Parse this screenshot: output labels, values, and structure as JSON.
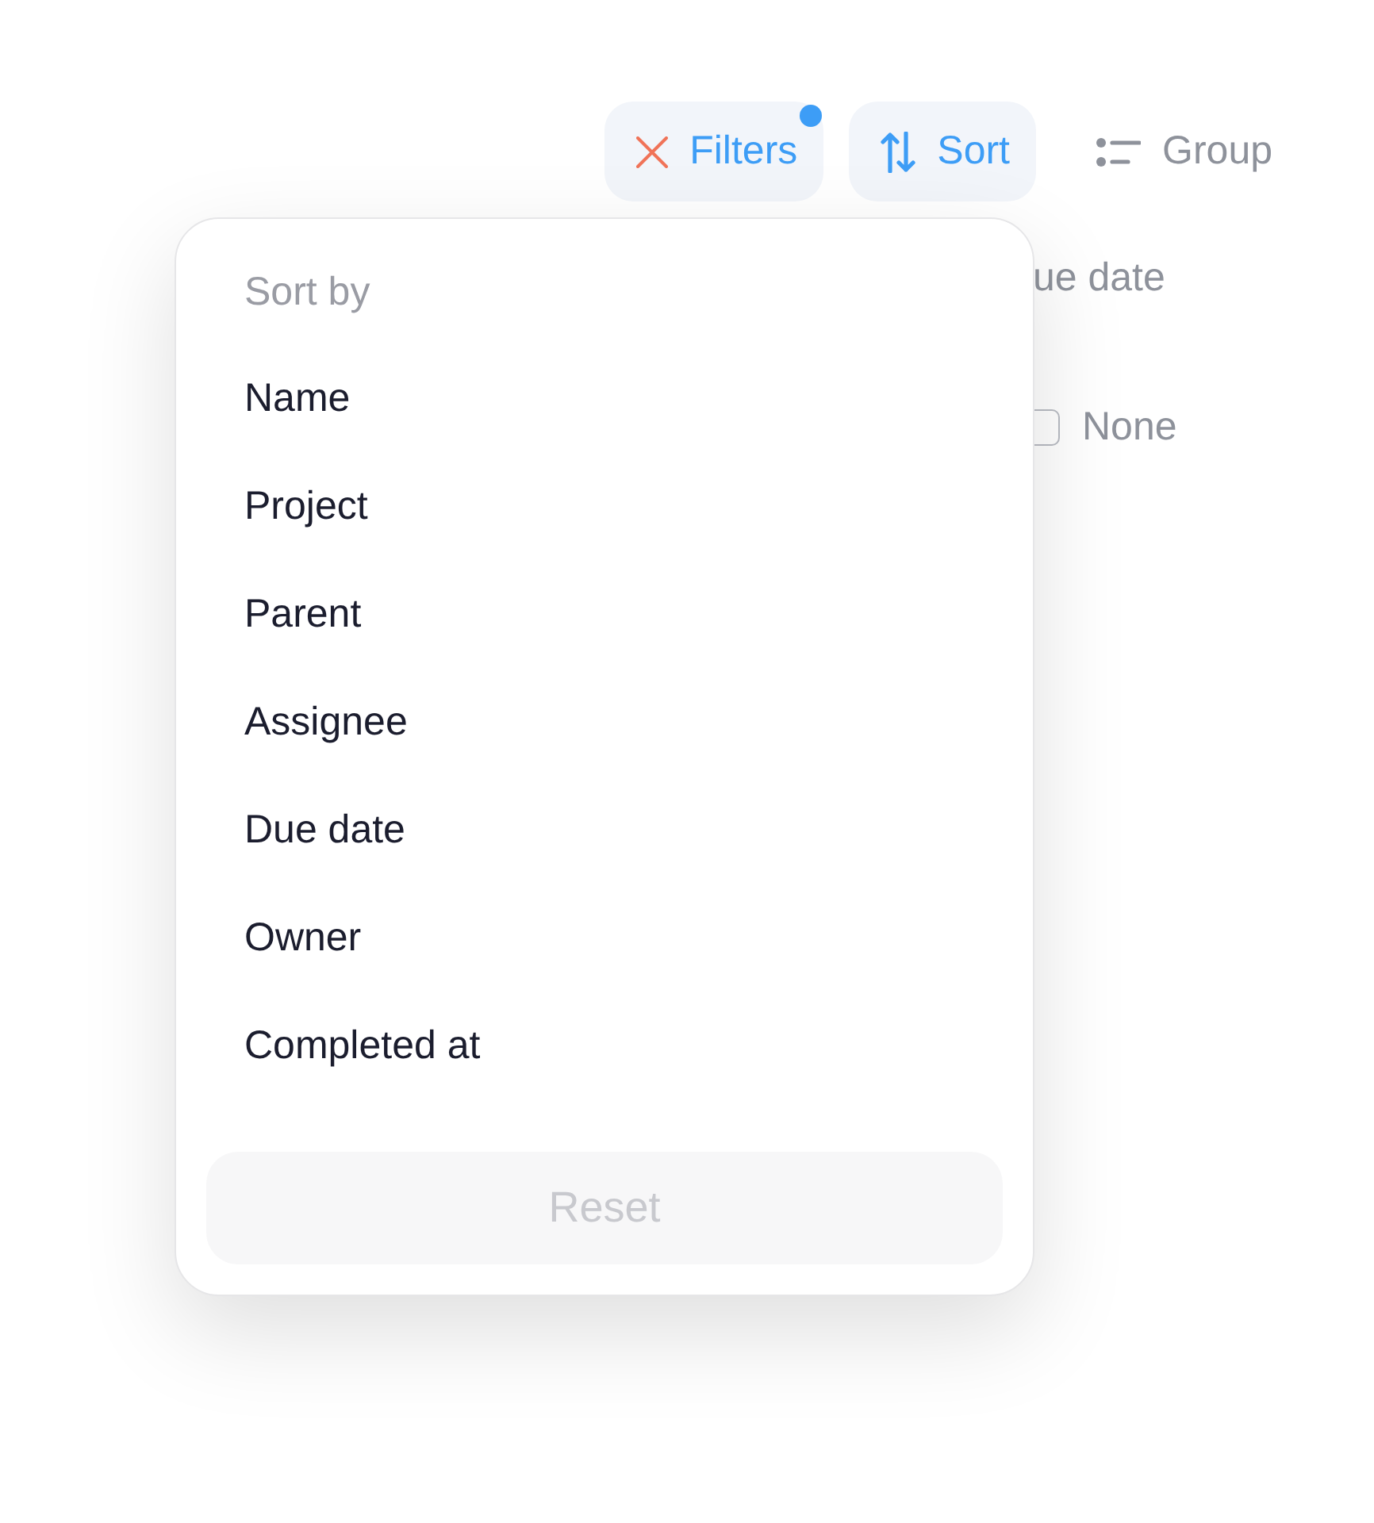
{
  "toolbar": [
    {
      "kind": "filters",
      "label": "Filters",
      "selected": true,
      "indicator": true
    },
    {
      "kind": "sort",
      "label": "Sort",
      "selected": true,
      "indicator": false
    },
    {
      "kind": "group",
      "label": "Group",
      "selected": false,
      "indicator": false
    }
  ],
  "background_panel": {
    "label": "ue date",
    "options": [
      {
        "label": "None",
        "checked": false
      }
    ]
  },
  "sort_menu": {
    "title": "Sort by",
    "options": [
      {
        "label": "Name",
        "selected": false
      },
      {
        "label": "Project",
        "selected": false
      },
      {
        "label": "Parent",
        "selected": false
      },
      {
        "label": "Assignee",
        "selected": false
      },
      {
        "label": "Due date",
        "selected": false
      },
      {
        "label": "Owner",
        "selected": false
      },
      {
        "label": "Completed at",
        "selected": false
      }
    ],
    "reset": {
      "label": "Reset",
      "disabled": true
    }
  }
}
